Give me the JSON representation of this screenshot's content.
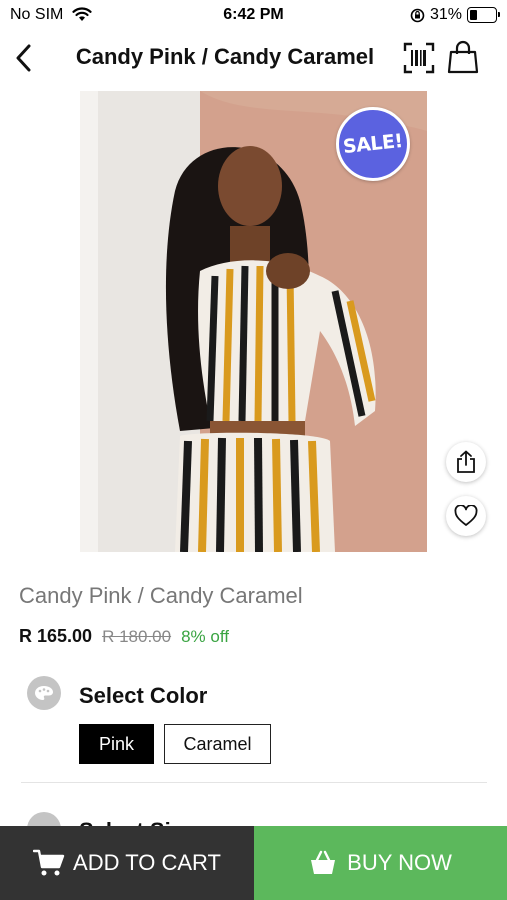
{
  "status_bar": {
    "carrier": "No SIM",
    "time": "6:42 PM",
    "battery": "31%",
    "battery_level": 0.31
  },
  "header": {
    "title": "Candy Pink / Candy Caramel"
  },
  "product": {
    "badge": "SALE!",
    "name": "Candy Pink / Candy Caramel",
    "price": "R 165.00",
    "original_price": "R 180.00",
    "discount": "8% off"
  },
  "color_section": {
    "label": "Select Color",
    "options": [
      "Pink",
      "Caramel"
    ],
    "selected": "Pink"
  },
  "size_section": {
    "label": "Select Size"
  },
  "actions": {
    "add_to_cart": "ADD TO CART",
    "buy_now": "BUY NOW"
  },
  "colors": {
    "sale_badge": "#5b62e0",
    "discount_text": "#3aa442",
    "add_to_cart_bg": "#333333",
    "buy_now_bg": "#5cb85c"
  }
}
